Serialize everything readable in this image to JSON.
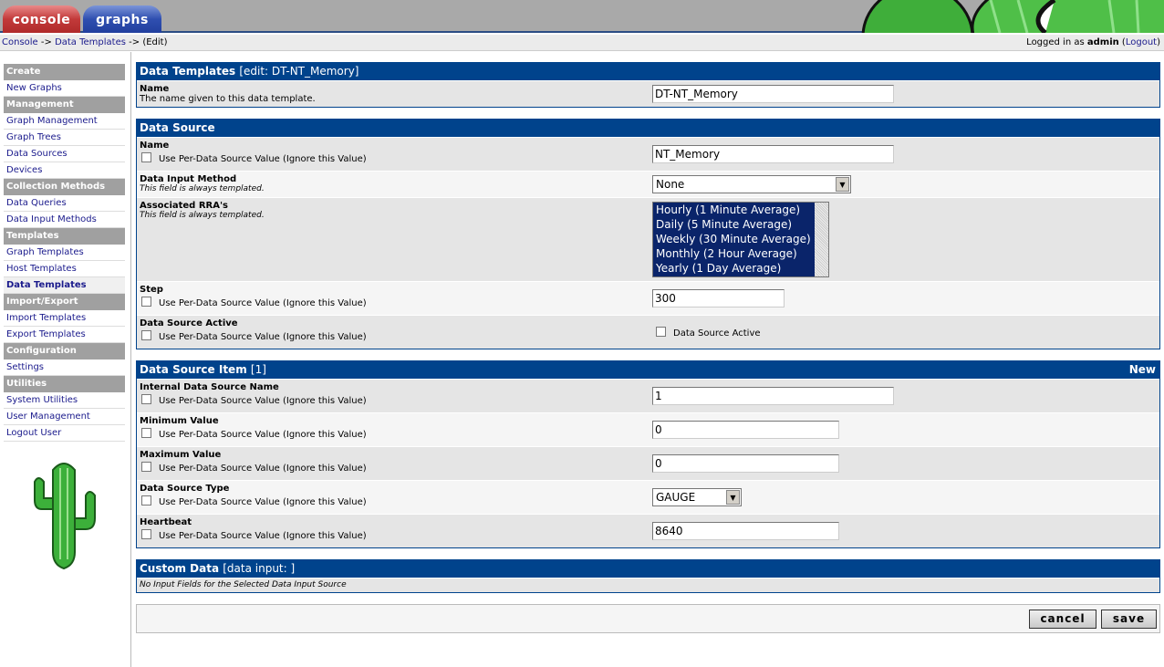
{
  "tabs": {
    "console": "console",
    "graphs": "graphs"
  },
  "breadcrumb": {
    "console": "Console",
    "sep": " -> ",
    "data_templates": "Data Templates",
    "edit": "(Edit)"
  },
  "login": {
    "prefix": "Logged in as ",
    "user": "admin",
    "logout": "Logout"
  },
  "sidebar": [
    {
      "type": "h",
      "label": "Create"
    },
    {
      "type": "i",
      "label": "New Graphs"
    },
    {
      "type": "h",
      "label": "Management"
    },
    {
      "type": "i",
      "label": "Graph Management"
    },
    {
      "type": "i",
      "label": "Graph Trees"
    },
    {
      "type": "i",
      "label": "Data Sources"
    },
    {
      "type": "i",
      "label": "Devices"
    },
    {
      "type": "h",
      "label": "Collection Methods"
    },
    {
      "type": "i",
      "label": "Data Queries"
    },
    {
      "type": "i",
      "label": "Data Input Methods"
    },
    {
      "type": "h",
      "label": "Templates"
    },
    {
      "type": "i",
      "label": "Graph Templates"
    },
    {
      "type": "i",
      "label": "Host Templates"
    },
    {
      "type": "i",
      "label": "Data Templates",
      "selected": true
    },
    {
      "type": "h",
      "label": "Import/Export"
    },
    {
      "type": "i",
      "label": "Import Templates"
    },
    {
      "type": "i",
      "label": "Export Templates"
    },
    {
      "type": "h",
      "label": "Configuration"
    },
    {
      "type": "i",
      "label": "Settings"
    },
    {
      "type": "h",
      "label": "Utilities"
    },
    {
      "type": "i",
      "label": "System Utilities"
    },
    {
      "type": "i",
      "label": "User Management"
    },
    {
      "type": "i",
      "label": "Logout User"
    }
  ],
  "per_ds_label": "Use Per-Data Source Value (Ignore this Value)",
  "sections": [
    {
      "title": "Data Templates",
      "sub": "[edit: DT-NT_Memory]",
      "rows": [
        {
          "label": "Name",
          "desc": "The name given to this data template.",
          "kind": "text",
          "value": "DT-NT_Memory",
          "w": 265
        }
      ]
    },
    {
      "title": "Data Source",
      "sub": "",
      "rows": [
        {
          "label": "Name",
          "perds": true,
          "kind": "text",
          "value": "NT_Memory",
          "w": 265
        },
        {
          "label": "Data Input Method",
          "note": "This field is always templated.",
          "kind": "select",
          "value": "None",
          "w": 218
        },
        {
          "label": "Associated RRA's",
          "note": "This field is always templated.",
          "kind": "list",
          "options": [
            "Hourly (1 Minute Average)",
            "Daily (5 Minute Average)",
            "Weekly (30 Minute Average)",
            "Monthly (2 Hour Average)",
            "Yearly (1 Day Average)"
          ]
        },
        {
          "label": "Step",
          "perds": true,
          "kind": "text",
          "value": "300",
          "w": 145
        },
        {
          "label": "Data Source Active",
          "perds": true,
          "kind": "check",
          "value": "Data Source Active"
        }
      ]
    },
    {
      "title": "Data Source Item",
      "sub": "[1]",
      "new": "New",
      "rows": [
        {
          "label": "Internal Data Source Name",
          "perds": true,
          "kind": "text",
          "value": "1",
          "w": 265
        },
        {
          "label": "Minimum Value",
          "perds": true,
          "kind": "text",
          "value": "0",
          "w": 205
        },
        {
          "label": "Maximum Value",
          "perds": true,
          "kind": "text",
          "value": "0",
          "w": 205
        },
        {
          "label": "Data Source Type",
          "perds": true,
          "kind": "select",
          "value": "GAUGE",
          "w": 98
        },
        {
          "label": "Heartbeat",
          "perds": true,
          "kind": "text",
          "value": "8640",
          "w": 205
        }
      ]
    },
    {
      "title": "Custom Data",
      "sub": "[data input: ]",
      "rows": [
        {
          "kind": "note",
          "note": "No Input Fields for the Selected Data Input Source"
        }
      ]
    }
  ],
  "buttons": {
    "cancel": "cancel",
    "save": "save"
  }
}
